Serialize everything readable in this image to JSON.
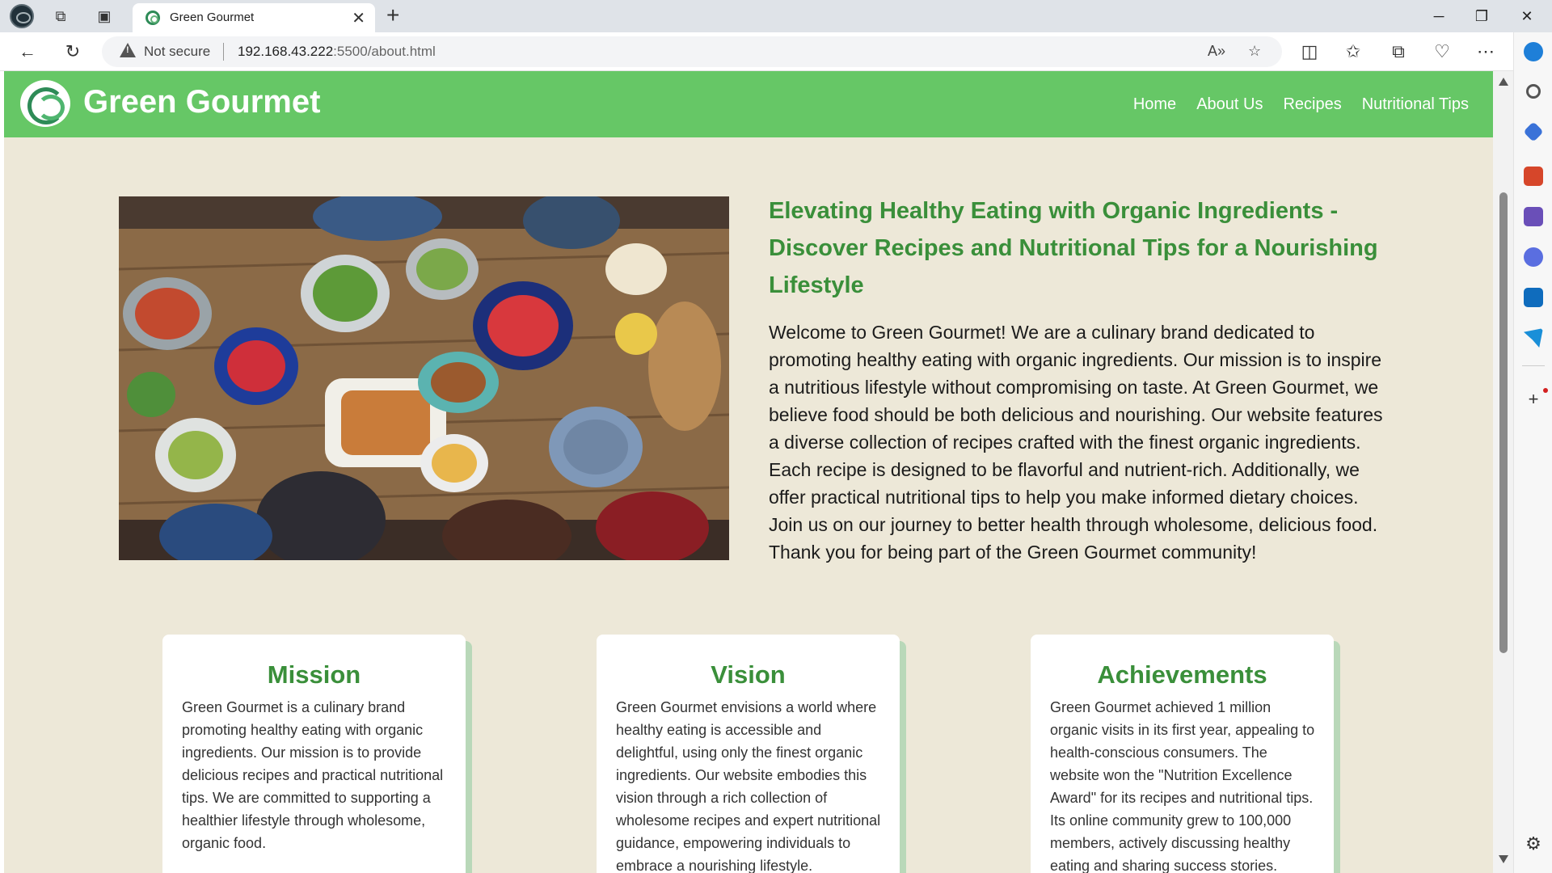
{
  "browser": {
    "tab_title": "Green Gourmet",
    "security_label": "Not secure",
    "url_host": "192.168.43.222",
    "url_path": ":5500/about.html",
    "new_tab_symbol": "+",
    "close_tab_symbol": "✕"
  },
  "site": {
    "brand": "Green Gourmet",
    "nav": [
      "Home",
      "About Us",
      "Recipes",
      "Nutritional Tips"
    ],
    "colors": {
      "header": "#66c766",
      "accent": "#3a8f3a",
      "background": "#ede8d8"
    }
  },
  "hero": {
    "title": "Elevating Healthy Eating with Organic Ingredients - Discover Recipes and Nutritional Tips for a Nourishing Lifestyle",
    "body": "Welcome to Green Gourmet! We are a culinary brand dedicated to promoting healthy eating with organic ingredients. Our mission is to inspire a nutritious lifestyle without compromising on taste. At Green Gourmet, we believe food should be both delicious and nourishing. Our website features a diverse collection of recipes crafted with the finest organic ingredients. Each recipe is designed to be flavorful and nutrient-rich. Additionally, we offer practical nutritional tips to help you make informed dietary choices. Join us on our journey to better health through wholesome, delicious food. Thank you for being part of the Green Gourmet community!"
  },
  "cards": [
    {
      "title": "Mission",
      "text": "Green Gourmet is a culinary brand promoting healthy eating with organic ingredients. Our mission is to provide delicious recipes and practical nutritional tips. We are committed to supporting a healthier lifestyle through wholesome, organic food."
    },
    {
      "title": "Vision",
      "text": "Green Gourmet envisions a world where healthy eating is accessible and delightful, using only the finest organic ingredients. Our website embodies this vision through a rich collection of wholesome recipes and expert nutritional guidance, empowering individuals to embrace a nourishing lifestyle."
    },
    {
      "title": "Achievements",
      "text": "Green Gourmet achieved 1 million organic visits in its first year, appealing to health-conscious consumers. The website won the \"Nutrition Excellence Award\" for its recipes and nutritional tips. Its online community grew to 100,000 members, actively discussing healthy eating and sharing success stories."
    }
  ]
}
